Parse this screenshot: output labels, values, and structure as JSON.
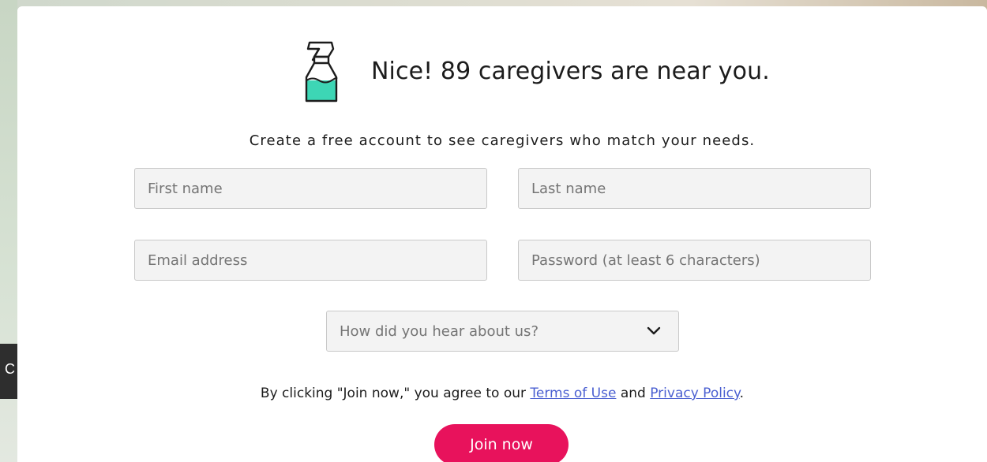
{
  "background": {
    "left_tab_text": "C"
  },
  "header": {
    "icon": "spray-bottle-icon",
    "headline": "Nice! 89 caregivers are near you."
  },
  "subhead": "Create a free account to see caregivers who match your needs.",
  "form": {
    "first_name": {
      "placeholder": "First name",
      "value": ""
    },
    "last_name": {
      "placeholder": "Last name",
      "value": ""
    },
    "email": {
      "placeholder": "Email address",
      "value": ""
    },
    "password": {
      "placeholder": "Password (at least 6 characters)",
      "value": ""
    },
    "referral": {
      "selected": "How did you hear about us?",
      "icon": "chevron-down-icon"
    }
  },
  "legal": {
    "prefix": "By clicking \"Join now,\" you agree to our ",
    "terms_link": "Terms of Use",
    "and": " and ",
    "privacy_link": "Privacy Policy",
    "suffix": "."
  },
  "join_button": "Join now",
  "colors": {
    "accent": "#e8125c",
    "link": "#4a5fd1",
    "icon_fill": "#3dd6b5"
  }
}
